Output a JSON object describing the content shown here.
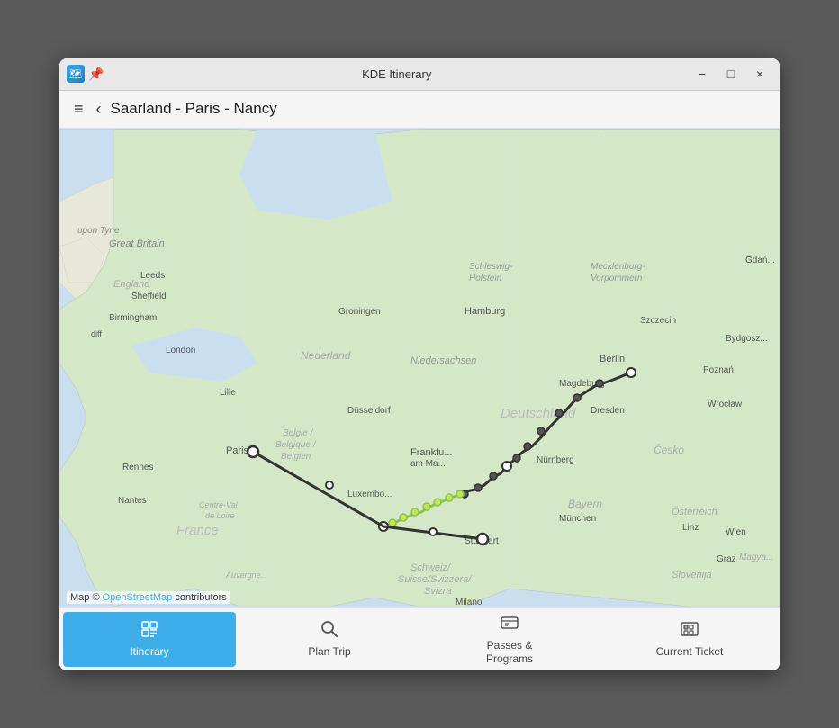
{
  "window": {
    "title": "KDE Itinerary",
    "icon": "🗺"
  },
  "titlebar": {
    "pin_icon": "📌",
    "minimize_label": "−",
    "maximize_label": "□",
    "close_label": "×"
  },
  "toolbar": {
    "hamburger_icon": "≡",
    "back_icon": "‹",
    "title": "Saarland - Paris - Nancy"
  },
  "map": {
    "attribution_prefix": "Map © ",
    "attribution_link_text": "OpenStreetMap",
    "attribution_suffix": " contributors"
  },
  "bottom_nav": {
    "items": [
      {
        "id": "itinerary",
        "label": "Itinerary",
        "icon": "itinerary",
        "active": true
      },
      {
        "id": "plan-trip",
        "label": "Plan Trip",
        "icon": "search",
        "active": false
      },
      {
        "id": "passes-programs",
        "label": "Passes &\nPrograms",
        "icon": "passes",
        "active": false
      },
      {
        "id": "current-ticket",
        "label": "Current Ticket",
        "icon": "ticket",
        "active": false
      }
    ]
  }
}
